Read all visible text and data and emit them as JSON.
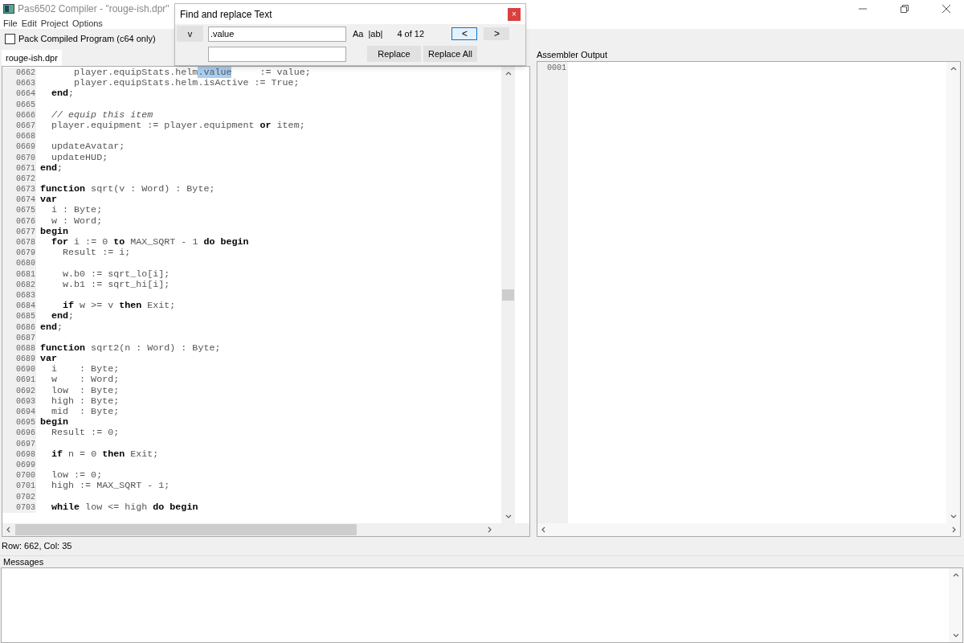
{
  "window": {
    "title": "Pas6502 Compiler - \"rouge-ish.dpr\""
  },
  "menu": [
    "File",
    "Edit",
    "Project",
    "Options"
  ],
  "toolbar": {
    "pack_checkbox": {
      "label": "Pack Compiled Program (c64 only)",
      "checked": false
    }
  },
  "tabs": [
    {
      "label": "rouge-ish.dpr",
      "selected": true
    }
  ],
  "editor": {
    "lines": [
      {
        "number": "0662",
        "segments": [
          {
            "kind": "plain",
            "text": "      player.equipStats.helm"
          },
          {
            "kind": "match",
            "text": ".value"
          },
          {
            "kind": "plain",
            "text": "     := value;"
          }
        ]
      },
      {
        "number": "0663",
        "segments": [
          {
            "kind": "plain",
            "text": "      player.equipStats.helm.isActive := True;"
          }
        ]
      },
      {
        "number": "0664",
        "segments": [
          {
            "kind": "keyword",
            "text": "  end"
          },
          {
            "kind": "plain",
            "text": ";"
          }
        ]
      },
      {
        "number": "0665"
      },
      {
        "number": "0666",
        "segments": [
          {
            "kind": "comment",
            "text": "  // equip this item"
          }
        ]
      },
      {
        "number": "0667",
        "segments": [
          {
            "kind": "plain",
            "text": "  player.equipment := player.equipment "
          },
          {
            "kind": "keyword",
            "text": "or"
          },
          {
            "kind": "plain",
            "text": " item;"
          }
        ]
      },
      {
        "number": "0668"
      },
      {
        "number": "0669",
        "segments": [
          {
            "kind": "plain",
            "text": "  updateAvatar;"
          }
        ]
      },
      {
        "number": "0670",
        "segments": [
          {
            "kind": "plain",
            "text": "  updateHUD;"
          }
        ]
      },
      {
        "number": "0671",
        "segments": [
          {
            "kind": "keyword",
            "text": "end"
          },
          {
            "kind": "plain",
            "text": ";"
          }
        ]
      },
      {
        "number": "0672"
      },
      {
        "number": "0673",
        "segments": [
          {
            "kind": "keyword",
            "text": "function"
          },
          {
            "kind": "plain",
            "text": " sqrt(v : Word) : Byte;"
          }
        ]
      },
      {
        "number": "0674",
        "segments": [
          {
            "kind": "keyword",
            "text": "var"
          }
        ]
      },
      {
        "number": "0675",
        "segments": [
          {
            "kind": "plain",
            "text": "  i : Byte;"
          }
        ]
      },
      {
        "number": "0676",
        "segments": [
          {
            "kind": "plain",
            "text": "  w : Word;"
          }
        ]
      },
      {
        "number": "0677",
        "segments": [
          {
            "kind": "keyword",
            "text": "begin"
          }
        ]
      },
      {
        "number": "0678",
        "segments": [
          {
            "kind": "keyword",
            "text": "  for"
          },
          {
            "kind": "plain",
            "text": " i := 0 "
          },
          {
            "kind": "keyword",
            "text": "to"
          },
          {
            "kind": "plain",
            "text": " MAX_SQRT - 1 "
          },
          {
            "kind": "keyword",
            "text": "do begin"
          }
        ]
      },
      {
        "number": "0679",
        "segments": [
          {
            "kind": "plain",
            "text": "    Result := i;"
          }
        ]
      },
      {
        "number": "0680"
      },
      {
        "number": "0681",
        "segments": [
          {
            "kind": "plain",
            "text": "    w.b0 := sqrt_lo[i];"
          }
        ]
      },
      {
        "number": "0682",
        "segments": [
          {
            "kind": "plain",
            "text": "    w.b1 := sqrt_hi[i];"
          }
        ]
      },
      {
        "number": "0683"
      },
      {
        "number": "0684",
        "segments": [
          {
            "kind": "keyword",
            "text": "    if"
          },
          {
            "kind": "plain",
            "text": " w >= v "
          },
          {
            "kind": "keyword",
            "text": "then"
          },
          {
            "kind": "plain",
            "text": " Exit;"
          }
        ]
      },
      {
        "number": "0685",
        "segments": [
          {
            "kind": "keyword",
            "text": "  end"
          },
          {
            "kind": "plain",
            "text": ";"
          }
        ]
      },
      {
        "number": "0686",
        "segments": [
          {
            "kind": "keyword",
            "text": "end"
          },
          {
            "kind": "plain",
            "text": ";"
          }
        ]
      },
      {
        "number": "0687"
      },
      {
        "number": "0688",
        "segments": [
          {
            "kind": "keyword",
            "text": "function"
          },
          {
            "kind": "plain",
            "text": " sqrt2(n : Word) : Byte;"
          }
        ]
      },
      {
        "number": "0689",
        "segments": [
          {
            "kind": "keyword",
            "text": "var"
          }
        ]
      },
      {
        "number": "0690",
        "segments": [
          {
            "kind": "plain",
            "text": "  i    : Byte;"
          }
        ]
      },
      {
        "number": "0691",
        "segments": [
          {
            "kind": "plain",
            "text": "  w    : Word;"
          }
        ]
      },
      {
        "number": "0692",
        "segments": [
          {
            "kind": "plain",
            "text": "  low  : Byte;"
          }
        ]
      },
      {
        "number": "0693",
        "segments": [
          {
            "kind": "plain",
            "text": "  high : Byte;"
          }
        ]
      },
      {
        "number": "0694",
        "segments": [
          {
            "kind": "plain",
            "text": "  mid  : Byte;"
          }
        ]
      },
      {
        "number": "0695",
        "segments": [
          {
            "kind": "keyword",
            "text": "begin"
          }
        ]
      },
      {
        "number": "0696",
        "segments": [
          {
            "kind": "plain",
            "text": "  Result := 0;"
          }
        ]
      },
      {
        "number": "0697"
      },
      {
        "number": "0698",
        "segments": [
          {
            "kind": "keyword",
            "text": "  if"
          },
          {
            "kind": "plain",
            "text": " n = 0 "
          },
          {
            "kind": "keyword",
            "text": "then"
          },
          {
            "kind": "plain",
            "text": " Exit;"
          }
        ]
      },
      {
        "number": "0699"
      },
      {
        "number": "0700",
        "segments": [
          {
            "kind": "plain",
            "text": "  low := 0;"
          }
        ]
      },
      {
        "number": "0701",
        "segments": [
          {
            "kind": "plain",
            "text": "  high := MAX_SQRT - 1;"
          }
        ]
      },
      {
        "number": "0702"
      },
      {
        "number": "0703",
        "segments": [
          {
            "kind": "keyword",
            "text": "  while"
          },
          {
            "kind": "plain",
            "text": " low <= high "
          },
          {
            "kind": "keyword",
            "text": "do begin"
          }
        ]
      }
    ]
  },
  "assembler_output": {
    "title": "Assembler Output",
    "lines": [
      {
        "number": "0001"
      }
    ]
  },
  "status_bar": {
    "text": "Row: 662, Col: 35"
  },
  "messages": {
    "title": "Messages"
  },
  "find_dialog": {
    "title": "Find and replace Text",
    "close": "×",
    "options_button": "v",
    "find_value": ".value",
    "match_case": "Aa",
    "whole_word": "|ab|",
    "count": "4 of 12",
    "nav_buttons": [
      {
        "label": "<",
        "selected": true
      },
      {
        "label": ">",
        "selected": false
      }
    ],
    "replace_buttons": [
      "Replace",
      "Replace All"
    ]
  }
}
